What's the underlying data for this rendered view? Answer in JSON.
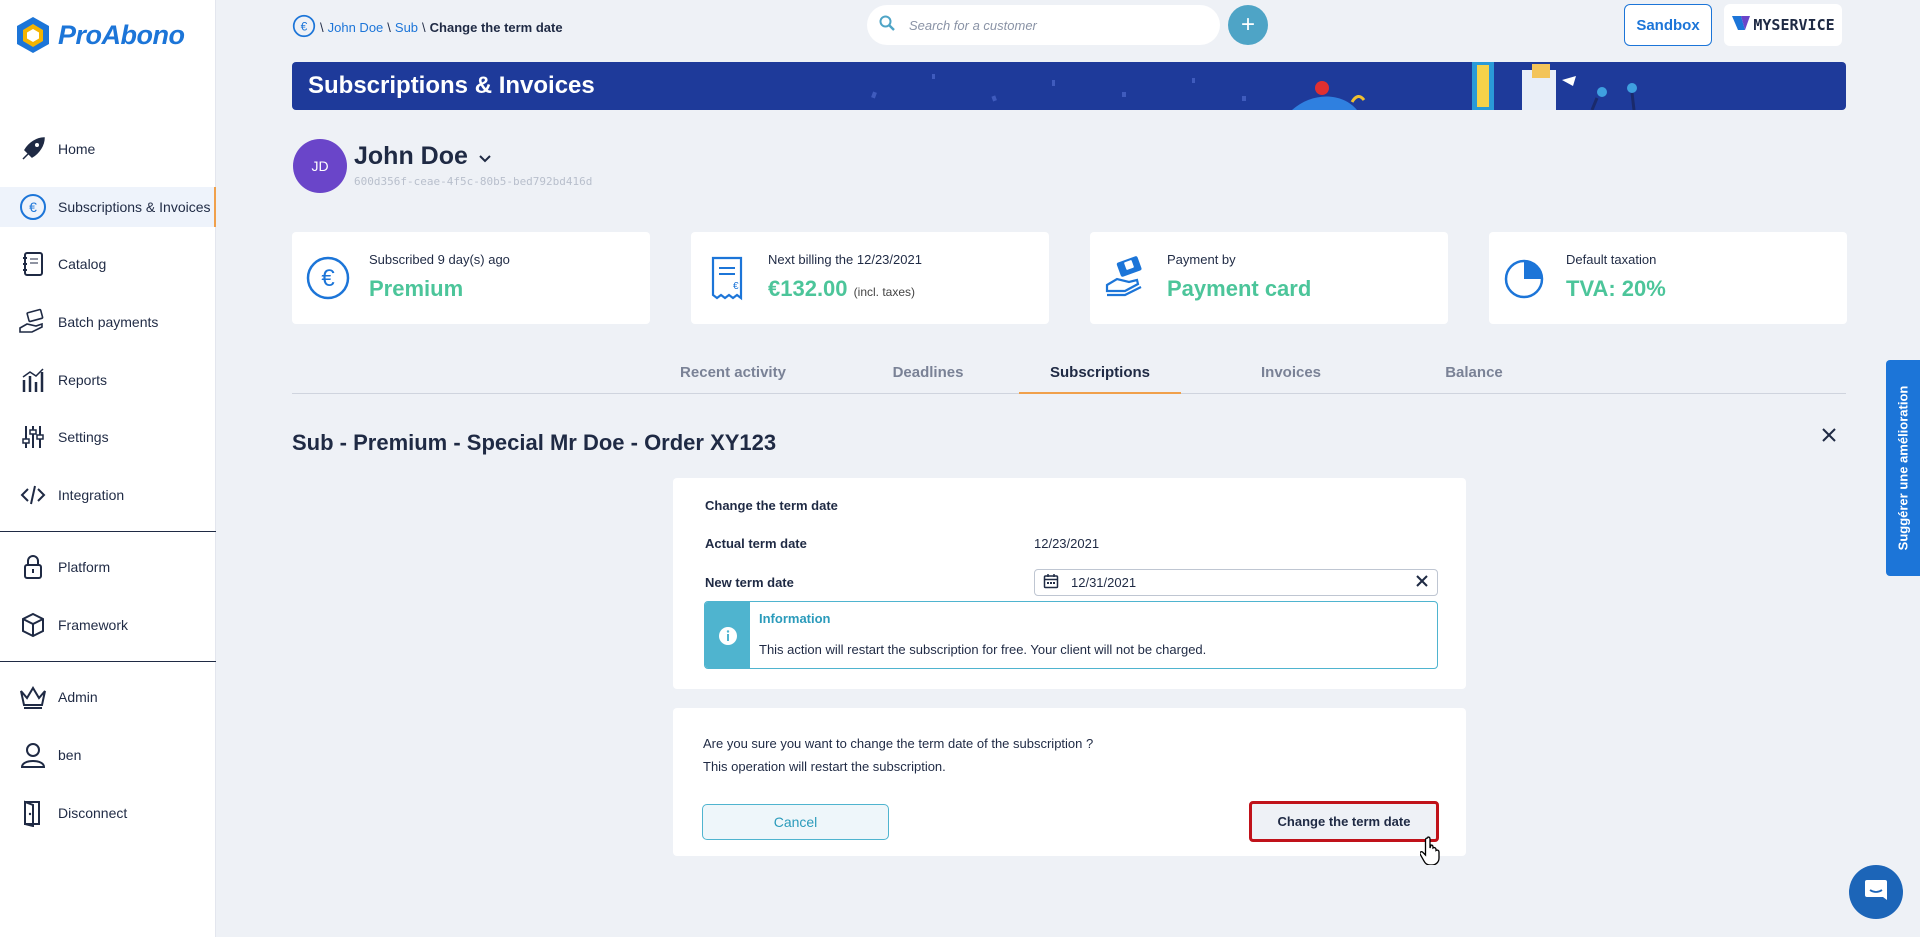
{
  "app": {
    "logo_text": "ProAbono"
  },
  "sidebar": {
    "items": [
      {
        "label": "Home",
        "icon": "rocket-icon"
      },
      {
        "label": "Subscriptions & Invoices",
        "icon": "euro-icon",
        "active": true
      },
      {
        "label": "Catalog",
        "icon": "notebook-icon"
      },
      {
        "label": "Batch payments",
        "icon": "hand-money-icon"
      },
      {
        "label": "Reports",
        "icon": "bar-chart-icon"
      },
      {
        "label": "Settings",
        "icon": "sliders-icon"
      },
      {
        "label": "Integration",
        "icon": "code-icon"
      },
      {
        "label": "Platform",
        "icon": "lock-icon"
      },
      {
        "label": "Framework",
        "icon": "cube-icon"
      },
      {
        "label": "Admin",
        "icon": "crown-icon"
      },
      {
        "label": "ben",
        "icon": "user-icon"
      },
      {
        "label": "Disconnect",
        "icon": "door-icon"
      }
    ]
  },
  "header": {
    "breadcrumb": [
      "John Doe",
      "Sub",
      "Change the term date"
    ],
    "search_placeholder": "Search for a customer",
    "add_label": "+",
    "sandbox_label": "Sandbox",
    "account_label": "MYSERVICE"
  },
  "banner": {
    "title": "Subscriptions & Invoices"
  },
  "customer": {
    "initials": "JD",
    "name": "John Doe",
    "id": "600d356f-ceae-4f5c-80b5-bed792bd416d"
  },
  "cards": [
    {
      "label": "Subscribed 9 day(s) ago",
      "value": "Premium",
      "note": "",
      "icon": "euro-icon"
    },
    {
      "label": "Next billing the 12/23/2021",
      "value": "€132.00",
      "note": "(incl. taxes)",
      "icon": "invoice-icon"
    },
    {
      "label": "Payment by",
      "value": "Payment card",
      "note": "",
      "icon": "card-hand-icon"
    },
    {
      "label": "Default taxation",
      "value": "TVA: 20%",
      "note": "",
      "icon": "pie-icon"
    }
  ],
  "tabs": [
    "Recent activity",
    "Deadlines",
    "Subscriptions",
    "Invoices",
    "Balance"
  ],
  "active_tab": "Subscriptions",
  "subscription": {
    "title": "Sub - Premium - Special Mr Doe - Order XY123"
  },
  "form": {
    "heading": "Change the term date",
    "actual_label": "Actual term date",
    "actual_value": "12/23/2021",
    "new_label": "New term date",
    "new_value": "12/31/2021",
    "info_title": "Information",
    "info_text": "This action will restart the subscription for free. Your client will not be charged."
  },
  "confirm": {
    "line1": "Are you sure you want to change the term date of the subscription ?",
    "line2": "This operation will restart the subscription.",
    "cancel_label": "Cancel",
    "confirm_label": "Change the term date"
  },
  "float": {
    "suggest_label": "Suggérer une amélioration"
  },
  "colors": {
    "accent": "#1c75d8",
    "banner": "#1e3a9a",
    "value_green": "#4cc59a",
    "highlight": "#c0121a",
    "info": "#4fb4cf",
    "active_tab": "#f0a04b"
  }
}
